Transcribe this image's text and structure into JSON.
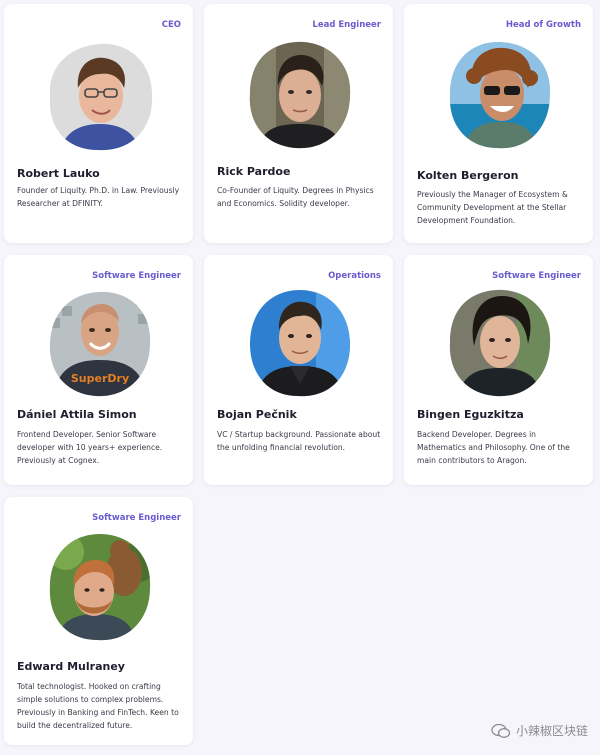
{
  "team": [
    {
      "role": "CEO",
      "name": "Robert Lauko",
      "bio": "Founder of Liquity. Ph.D. in Law. Previously Researcher at DFINITY."
    },
    {
      "role": "Lead Engineer",
      "name": "Rick Pardoe",
      "bio": "Co-Founder of Liquity. Degrees in Physics and Economics. Solidity developer."
    },
    {
      "role": "Head of Growth",
      "name": "Kolten Bergeron",
      "bio": "Previously the Manager of Ecosystem & Community Development at the Stellar Development Foundation."
    },
    {
      "role": "Software Engineer",
      "name": "Dániel Attila Simon",
      "bio": "Frontend Developer. Senior Software developer with 10 years+ experience. Previously at Cognex."
    },
    {
      "role": "Operations",
      "name": "Bojan Pečnik",
      "bio": "VC / Startup background. Passionate about the unfolding financial revolution."
    },
    {
      "role": "Software Engineer",
      "name": "Bingen Eguzkitza",
      "bio": "Backend Developer. Degrees in Mathematics and Philosophy. One of the main contributors to Aragon."
    },
    {
      "role": "Software Engineer",
      "name": "Edward Mulraney",
      "bio": "Total technologist. Hooked on crafting simple solutions to complex problems. Previously in Banking and FinTech. Keen to build the decentralized future."
    }
  ],
  "watermark": {
    "text": "小辣椒区块链"
  },
  "colors": {
    "accent": "#6a5ccf",
    "background": "#f5f5fb",
    "card": "#ffffff"
  }
}
